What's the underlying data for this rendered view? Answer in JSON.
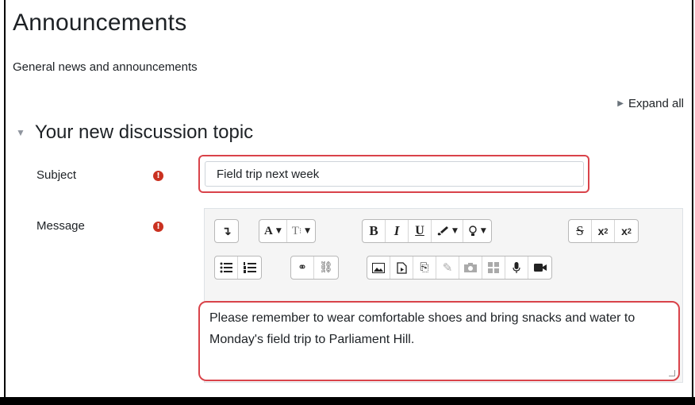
{
  "page": {
    "title": "Announcements",
    "subtitle": "General news and announcements",
    "expand_all": "Expand all"
  },
  "section": {
    "title": "Your new discussion topic"
  },
  "form": {
    "subject_label": "Subject",
    "subject_value": "Field trip next week",
    "message_label": "Message",
    "message_text": "Please remember to wear comfortable shoes and bring snacks and water to Monday's field trip to Parliament Hill.",
    "required_symbol": "!"
  },
  "toolbar": {
    "row1": [
      {
        "group": [
          {
            "icon": "undo-arrow-icon",
            "glyph": "↴"
          }
        ]
      },
      {
        "group": [
          {
            "icon": "font-color-icon",
            "glyph": "A"
          },
          {
            "icon": "font-size-icon",
            "glyph": "Tᵢ"
          }
        ]
      },
      {
        "group": [
          {
            "icon": "bold-icon",
            "glyph": "B"
          },
          {
            "icon": "italic-icon",
            "glyph": "I"
          },
          {
            "icon": "underline-icon",
            "glyph": "U"
          },
          {
            "icon": "paintbrush-icon",
            "glyph": "🖌"
          },
          {
            "icon": "lightbulb-icon",
            "glyph": "💡"
          }
        ]
      },
      {
        "group": [
          {
            "icon": "strikethrough-icon",
            "glyph": "S"
          },
          {
            "icon": "subscript-icon",
            "glyph": "x₂"
          },
          {
            "icon": "superscript-icon",
            "glyph": "x²"
          }
        ]
      }
    ],
    "row2": [
      {
        "group": [
          {
            "icon": "bullet-list-icon"
          },
          {
            "icon": "numbered-list-icon"
          }
        ]
      },
      {
        "group": [
          {
            "icon": "link-icon"
          },
          {
            "icon": "unlink-icon"
          }
        ]
      },
      {
        "group": [
          {
            "icon": "image-icon"
          },
          {
            "icon": "media-icon"
          },
          {
            "icon": "manage-files-icon"
          },
          {
            "icon": "pencil-icon"
          },
          {
            "icon": "camera-icon"
          },
          {
            "icon": "table-icon"
          },
          {
            "icon": "microphone-icon"
          },
          {
            "icon": "video-icon"
          }
        ]
      }
    ]
  },
  "colors": {
    "required": "#ca3120",
    "highlight_border": "#d9434a",
    "text": "#1d2125"
  }
}
